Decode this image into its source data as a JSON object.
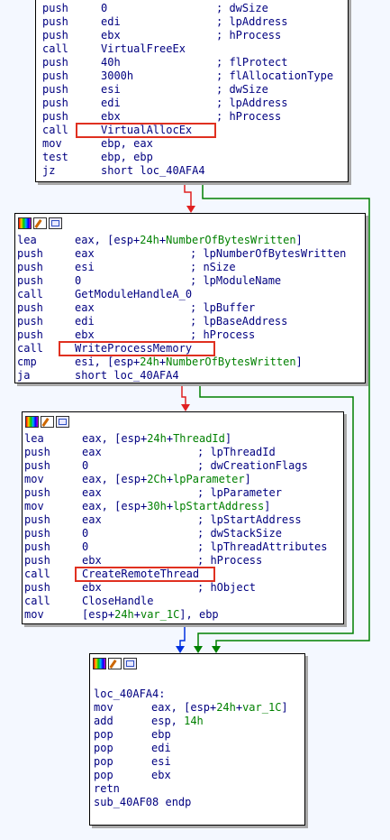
{
  "icons": [
    "color-icon",
    "edit-icon",
    "graph-icon"
  ],
  "colors": {
    "text": "#000080",
    "highlight": "#008000",
    "background": "#f4f8ff",
    "true_edge": "#008000",
    "false_edge": "#e02020",
    "flow_edge": "#0030e0",
    "callout": "#e03020"
  },
  "blocks": [
    {
      "lines": [
        {
          "m": "push",
          "o": "0",
          "h": "",
          "h2": "",
          "c": "; dwSize"
        },
        {
          "m": "push",
          "o": "edi",
          "h": "",
          "h2": "",
          "c": "; lpAddress"
        },
        {
          "m": "push",
          "o": "ebx",
          "h": "",
          "h2": "",
          "c": "; hProcess"
        },
        {
          "m": "call",
          "o": "VirtualFreeEx",
          "h": "",
          "h2": "",
          "c": ""
        },
        {
          "m": "push",
          "o": "40h",
          "h": "",
          "h2": "",
          "c": "; flProtect"
        },
        {
          "m": "push",
          "o": "3000h",
          "h": "",
          "h2": "",
          "c": "; flAllocationType"
        },
        {
          "m": "push",
          "o": "esi",
          "h": "",
          "h2": "",
          "c": "; dwSize"
        },
        {
          "m": "push",
          "o": "edi",
          "h": "",
          "h2": "",
          "c": "; lpAddress"
        },
        {
          "m": "push",
          "o": "ebx",
          "h": "",
          "h2": "",
          "c": "; hProcess"
        },
        {
          "m": "call",
          "o": "VirtualAllocEx",
          "h": "",
          "h2": "",
          "c": ""
        },
        {
          "m": "mov",
          "o": "ebp, eax",
          "h": "",
          "h2": "",
          "c": ""
        },
        {
          "m": "test",
          "o": "ebp, ebp",
          "h": "",
          "h2": "",
          "c": ""
        },
        {
          "m": "jz",
          "o": "short loc_40AFA4",
          "h": "",
          "h2": "",
          "c": ""
        }
      ]
    },
    {
      "lines": [
        {
          "m": "lea",
          "o": "eax, [esp+",
          "h": "24h",
          "o2": "+",
          "h2": "NumberOfBytesWritten",
          "o3": "]",
          "c": ""
        },
        {
          "m": "push",
          "o": "eax",
          "h": "",
          "h2": "",
          "c": "; lpNumberOfBytesWritten"
        },
        {
          "m": "push",
          "o": "esi",
          "h": "",
          "h2": "",
          "c": "; nSize"
        },
        {
          "m": "push",
          "o": "0",
          "h": "",
          "h2": "",
          "c": "; lpModuleName"
        },
        {
          "m": "call",
          "o": "GetModuleHandleA_0",
          "h": "",
          "h2": "",
          "c": ""
        },
        {
          "m": "push",
          "o": "eax",
          "h": "",
          "h2": "",
          "c": "; lpBuffer"
        },
        {
          "m": "push",
          "o": "edi",
          "h": "",
          "h2": "",
          "c": "; lpBaseAddress"
        },
        {
          "m": "push",
          "o": "ebx",
          "h": "",
          "h2": "",
          "c": "; hProcess"
        },
        {
          "m": "call",
          "o": "WriteProcessMemory",
          "h": "",
          "h2": "",
          "c": ""
        },
        {
          "m": "cmp",
          "o": "esi, [esp+",
          "h": "24h",
          "o2": "+",
          "h2": "NumberOfBytesWritten",
          "o3": "]",
          "c": ""
        },
        {
          "m": "ja",
          "o": "short loc_40AFA4",
          "h": "",
          "h2": "",
          "c": ""
        }
      ]
    },
    {
      "lines": [
        {
          "m": "lea",
          "o": "eax, [esp+",
          "h": "24h",
          "o2": "+",
          "h2": "ThreadId",
          "o3": "]",
          "c": ""
        },
        {
          "m": "push",
          "o": "eax",
          "h": "",
          "h2": "",
          "c": "; lpThreadId"
        },
        {
          "m": "push",
          "o": "0",
          "h": "",
          "h2": "",
          "c": "; dwCreationFlags"
        },
        {
          "m": "mov",
          "o": "eax, [esp+",
          "h": "2Ch",
          "o2": "+",
          "h2": "lpParameter",
          "o3": "]",
          "c": ""
        },
        {
          "m": "push",
          "o": "eax",
          "h": "",
          "h2": "",
          "c": "; lpParameter"
        },
        {
          "m": "mov",
          "o": "eax, [esp+",
          "h": "30h",
          "o2": "+",
          "h2": "lpStartAddress",
          "o3": "]",
          "c": ""
        },
        {
          "m": "push",
          "o": "eax",
          "h": "",
          "h2": "",
          "c": "; lpStartAddress"
        },
        {
          "m": "push",
          "o": "0",
          "h": "",
          "h2": "",
          "c": "; dwStackSize"
        },
        {
          "m": "push",
          "o": "0",
          "h": "",
          "h2": "",
          "c": "; lpThreadAttributes"
        },
        {
          "m": "push",
          "o": "ebx",
          "h": "",
          "h2": "",
          "c": "; hProcess"
        },
        {
          "m": "call",
          "o": "CreateRemoteThread",
          "h": "",
          "h2": "",
          "c": ""
        },
        {
          "m": "push",
          "o": "ebx",
          "h": "",
          "h2": "",
          "c": "; hObject"
        },
        {
          "m": "call",
          "o": "CloseHandle",
          "h": "",
          "h2": "",
          "c": ""
        },
        {
          "m": "mov",
          "o": "[esp+",
          "h": "24h",
          "o2": "+",
          "h2": "var_1C",
          "o3": "], ebp",
          "c": ""
        }
      ]
    },
    {
      "lines": [
        {
          "m": "",
          "o": "",
          "h": "",
          "h2": "",
          "c": ""
        },
        {
          "m": "loc_40AFA4:",
          "o": "",
          "h": "",
          "h2": "",
          "c": ""
        },
        {
          "m": "mov",
          "o": "eax, [esp+",
          "h": "24h",
          "o2": "+",
          "h2": "var_1C",
          "o3": "]",
          "c": ""
        },
        {
          "m": "add",
          "o": "esp, ",
          "h": "14h",
          "h2": "",
          "c": ""
        },
        {
          "m": "pop",
          "o": "ebp",
          "h": "",
          "h2": "",
          "c": ""
        },
        {
          "m": "pop",
          "o": "edi",
          "h": "",
          "h2": "",
          "c": ""
        },
        {
          "m": "pop",
          "o": "esi",
          "h": "",
          "h2": "",
          "c": ""
        },
        {
          "m": "pop",
          "o": "ebx",
          "h": "",
          "h2": "",
          "c": ""
        },
        {
          "m": "retn",
          "o": "",
          "h": "",
          "h2": "",
          "c": ""
        },
        {
          "m": "sub_40AF08 endp",
          "o": "",
          "h": "",
          "h2": "",
          "c": ""
        }
      ]
    }
  ]
}
